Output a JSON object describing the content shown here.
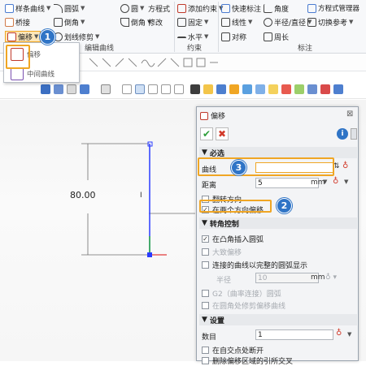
{
  "ribbon": {
    "spline": "样条曲线",
    "bridge": "桥接",
    "offset": "偏移",
    "arc": "圆弧",
    "chamfer": "倒角",
    "line_trim": "划线修剪",
    "circle": "圆",
    "fillet": "倒角",
    "equation": "方程式",
    "modify": "修改",
    "edit_group": "编辑曲线",
    "add_constraint": "添加约束",
    "fixed": "固定",
    "horizontal": "水平",
    "constraint_group": "约束",
    "quick_dim": "快速标注",
    "linear": "线性",
    "symmetric": "对称",
    "angle": "角度",
    "radius_dia": "半径/直径",
    "perimeter": "周长",
    "equation_mgr": "方程式管理器",
    "switch_ref": "切换参考",
    "dim_group": "标注"
  },
  "popup": {
    "offset": "偏移",
    "mid_curve": "中间曲线"
  },
  "canvas": {
    "dimension": "80.00",
    "cursor": "I"
  },
  "dialog": {
    "title": "偏移",
    "required_section": "必选",
    "curve_label": "曲线",
    "distance_label": "距离",
    "distance_value": "5",
    "distance_unit": "mm",
    "flip": "翻转方向",
    "both_dir": "在两个方向偏移",
    "corner_section": "转角控制",
    "insert_arc": "在凸角插入圆弧",
    "large_offset": "大致偏移",
    "connect_arc": "连接的曲线以完整的圆弧显示",
    "radius_label": "半径",
    "radius_value": "10",
    "radius_unit": "mm",
    "g2": "G2（曲率连接）圆弧",
    "trim_offset": "在圆角处修剪偏移曲线",
    "settings_section": "设置",
    "count_label": "数目",
    "count_value": "1",
    "self_intersect": "在自交点处断开",
    "delete_ref": "删除偏移区域的引所交叉"
  },
  "badges": [
    "1",
    "2",
    "3"
  ],
  "colors": {
    "accent_orange": "#f0a624",
    "badge_blue": "#2f74c6",
    "sketch_blue": "#2a3cff",
    "ok_green": "#2e9e3a",
    "cancel_red": "#d23a2a"
  }
}
